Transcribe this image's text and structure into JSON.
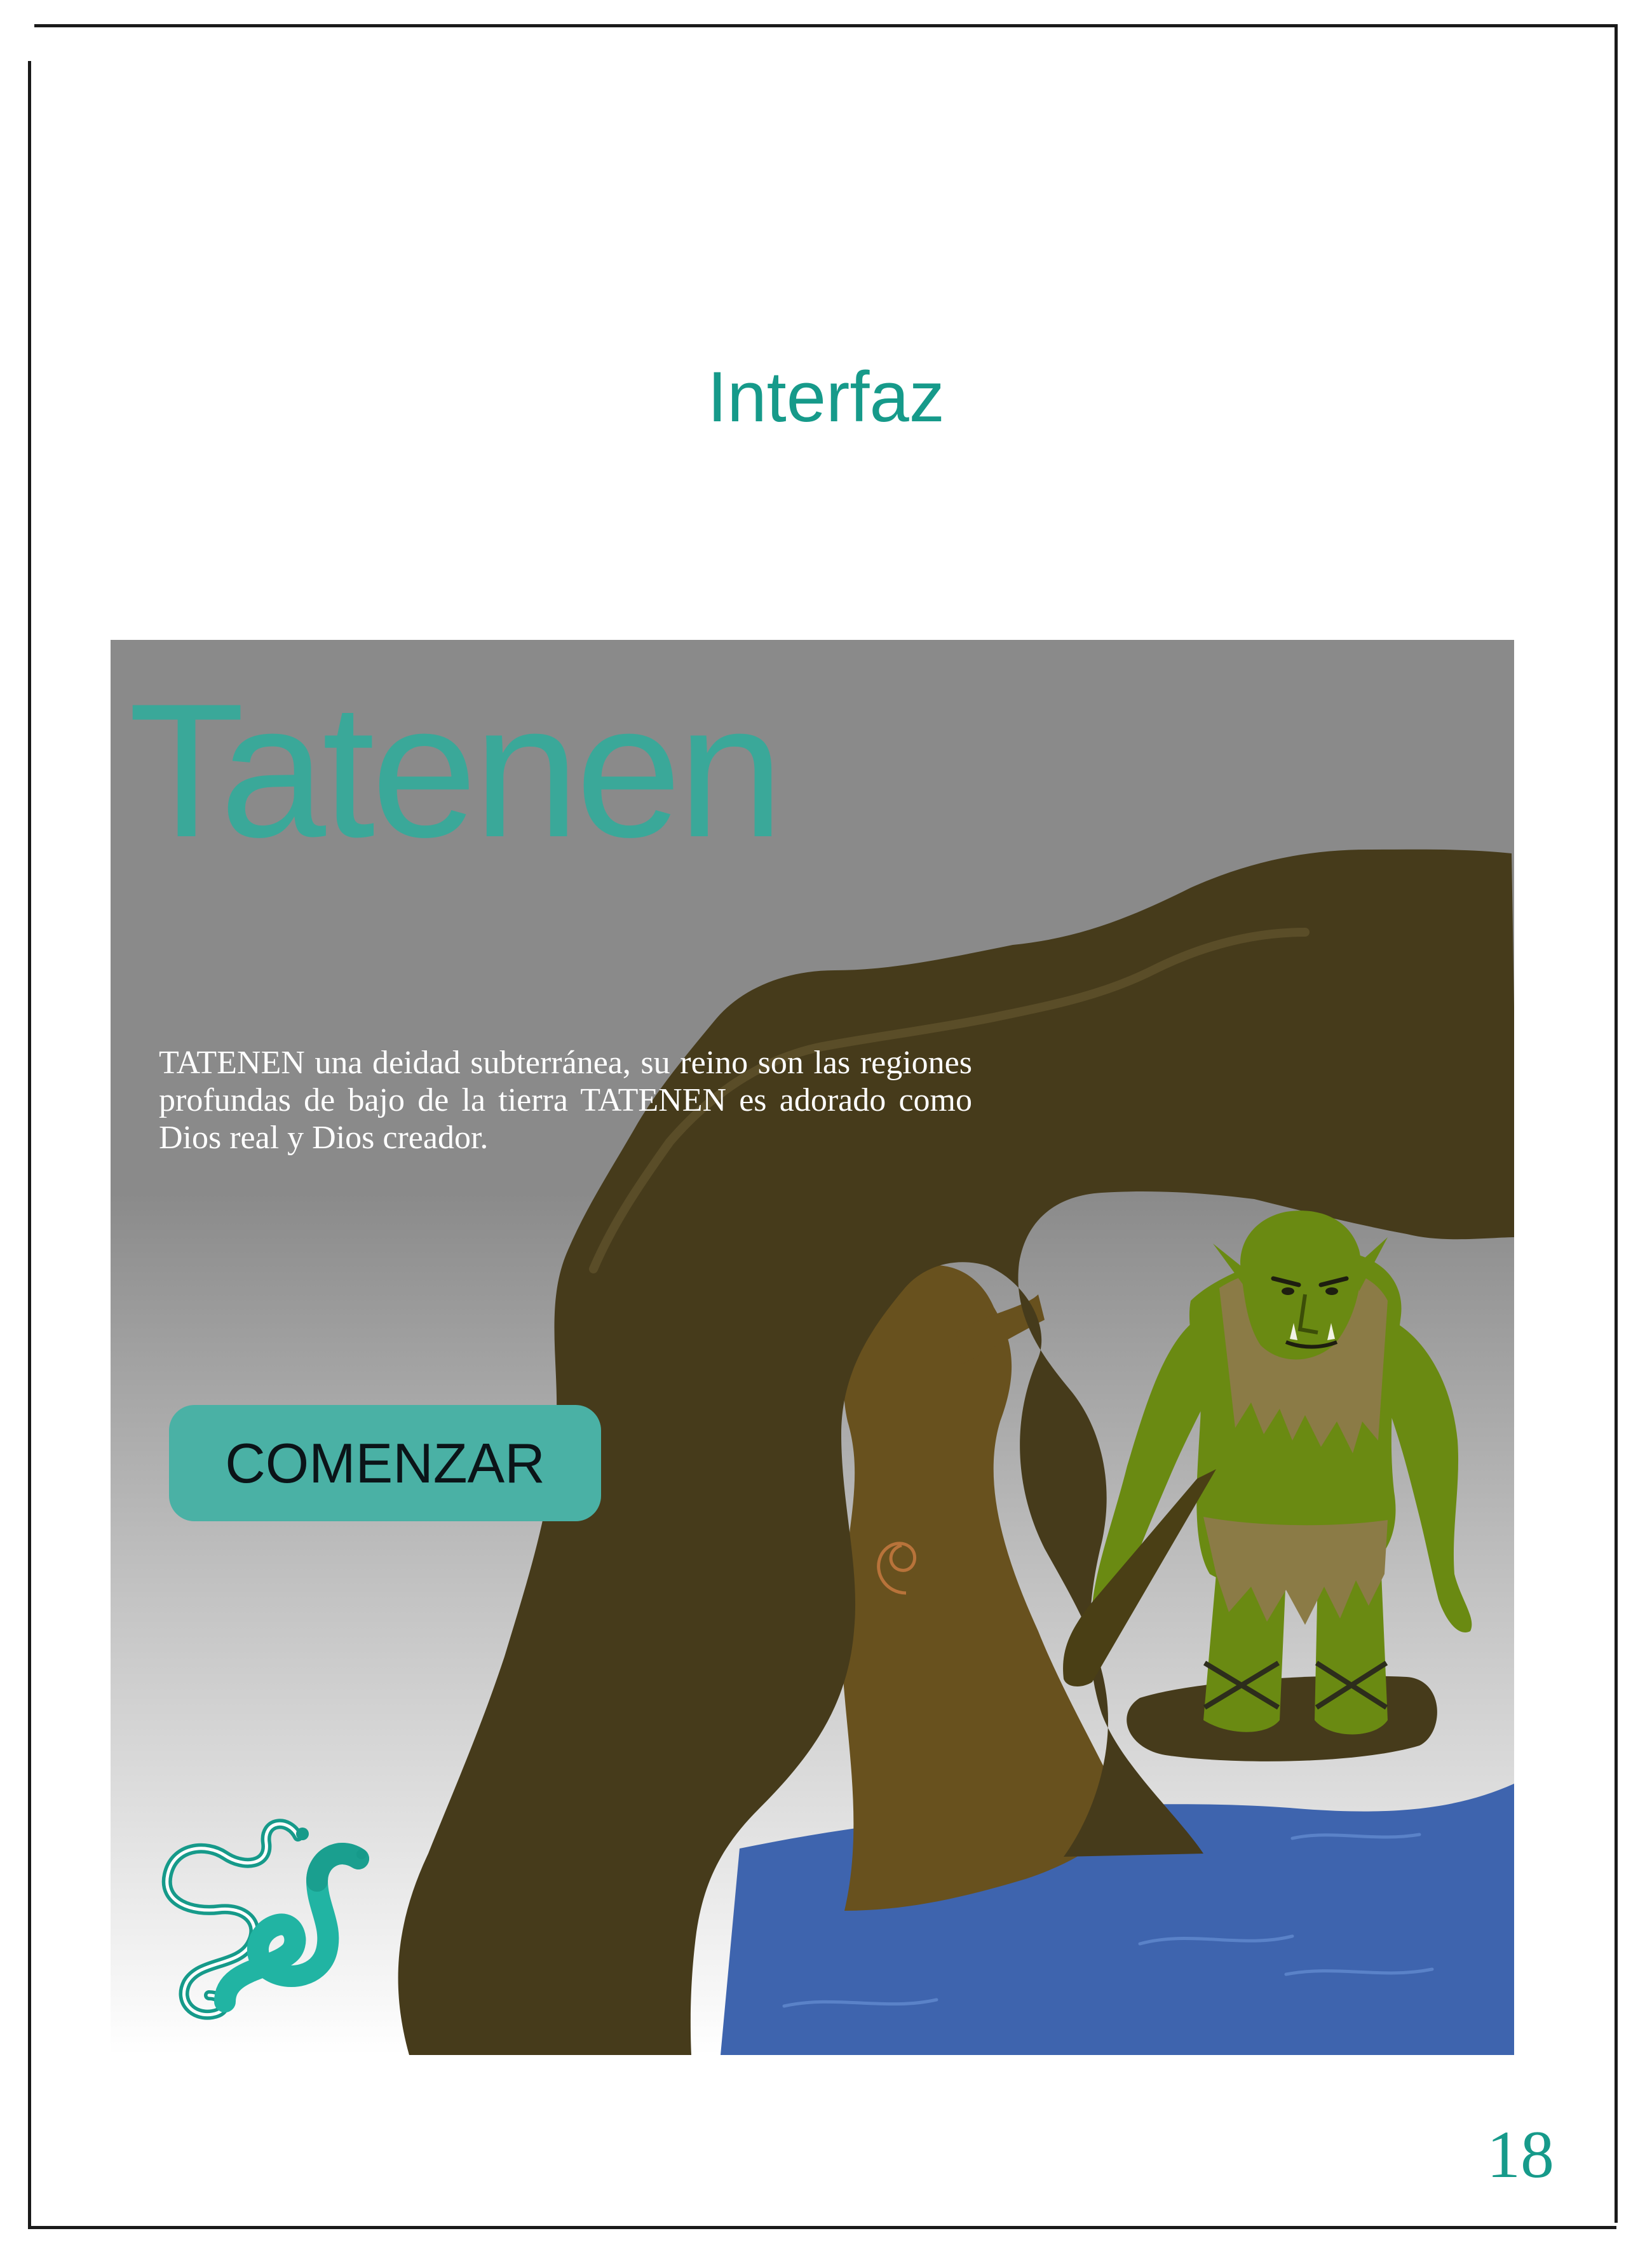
{
  "page": {
    "title": "Interfaz",
    "page_number": "18"
  },
  "game_screen": {
    "title": "Tatenen",
    "description": "TATENEN una deidad subterránea, su reino son las regiones profundas de bajo de la tierra TATENEN es adorado como Dios real y Dios creador.",
    "start_button_label": "COMENZAR"
  },
  "colors": {
    "accent": "#169a8a",
    "title_text": "#3aa899",
    "button": "#4ab1a5",
    "rock": "#463b1b",
    "tree": "#68511e",
    "water": "#3e64ae",
    "troll_skin": "#6a8a12"
  },
  "icons": [
    "snake-logo-icon",
    "troll-figure",
    "cave-arch",
    "water"
  ]
}
